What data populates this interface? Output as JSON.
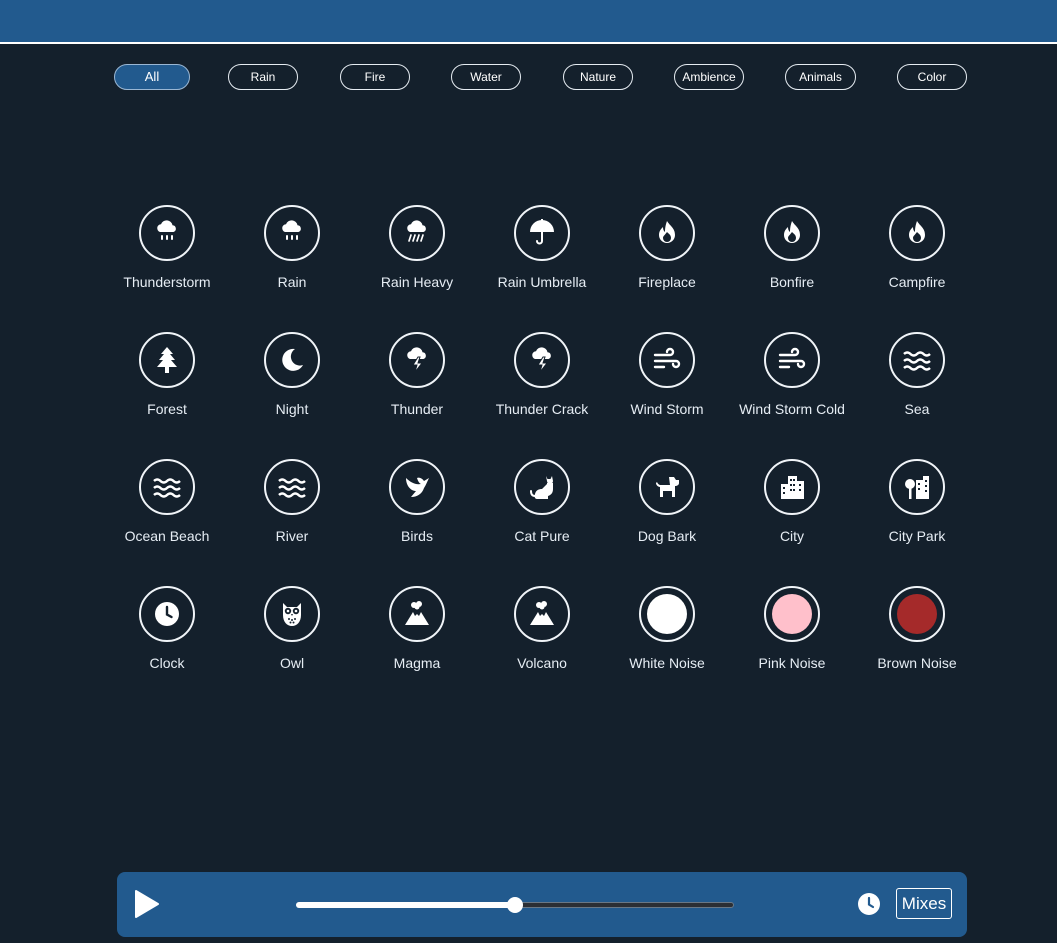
{
  "filters": [
    {
      "label": "All",
      "active": true
    },
    {
      "label": "Rain",
      "active": false
    },
    {
      "label": "Fire",
      "active": false
    },
    {
      "label": "Water",
      "active": false
    },
    {
      "label": "Nature",
      "active": false
    },
    {
      "label": "Ambience",
      "active": false
    },
    {
      "label": "Animals",
      "active": false
    },
    {
      "label": "Color",
      "active": false
    }
  ],
  "sounds": [
    {
      "label": "Thunderstorm",
      "icon": "cloud-rain-icon"
    },
    {
      "label": "Rain",
      "icon": "cloud-rain-icon"
    },
    {
      "label": "Rain Heavy",
      "icon": "cloud-showers-heavy-icon"
    },
    {
      "label": "Rain Umbrella",
      "icon": "umbrella-icon"
    },
    {
      "label": "Fireplace",
      "icon": "fire-icon"
    },
    {
      "label": "Bonfire",
      "icon": "fire-icon"
    },
    {
      "label": "Campfire",
      "icon": "fire-icon"
    },
    {
      "label": "Forest",
      "icon": "tree-icon"
    },
    {
      "label": "Night",
      "icon": "moon-icon"
    },
    {
      "label": "Thunder",
      "icon": "cloud-bolt-icon"
    },
    {
      "label": "Thunder Crack",
      "icon": "cloud-bolt-icon"
    },
    {
      "label": "Wind Storm",
      "icon": "wind-icon"
    },
    {
      "label": "Wind Storm Cold",
      "icon": "wind-icon"
    },
    {
      "label": "Sea",
      "icon": "water-icon"
    },
    {
      "label": "Ocean Beach",
      "icon": "water-icon"
    },
    {
      "label": "River",
      "icon": "water-icon"
    },
    {
      "label": "Birds",
      "icon": "dove-icon"
    },
    {
      "label": "Cat Pure",
      "icon": "cat-icon"
    },
    {
      "label": "Dog Bark",
      "icon": "dog-icon"
    },
    {
      "label": "City",
      "icon": "city-icon"
    },
    {
      "label": "City Park",
      "icon": "tree-city-icon"
    },
    {
      "label": "Clock",
      "icon": "clock-icon"
    },
    {
      "label": "Owl",
      "icon": "owl-icon"
    },
    {
      "label": "Magma",
      "icon": "volcano-icon"
    },
    {
      "label": "Volcano",
      "icon": "volcano-icon"
    },
    {
      "label": "White Noise",
      "icon": "noise-dot-icon",
      "color": "#ffffff"
    },
    {
      "label": "Pink Noise",
      "icon": "noise-dot-icon",
      "color": "#ffc0cb"
    },
    {
      "label": "Brown Noise",
      "icon": "noise-dot-icon",
      "color": "#a52a2a"
    }
  ],
  "player": {
    "play_icon": "play-icon",
    "volume_level": 0.5,
    "timer_icon": "clock-icon",
    "mixes_label": "Mixes"
  },
  "colors": {
    "background": "#14202c",
    "accent": "#225a8e",
    "icon": "#ffffff"
  }
}
